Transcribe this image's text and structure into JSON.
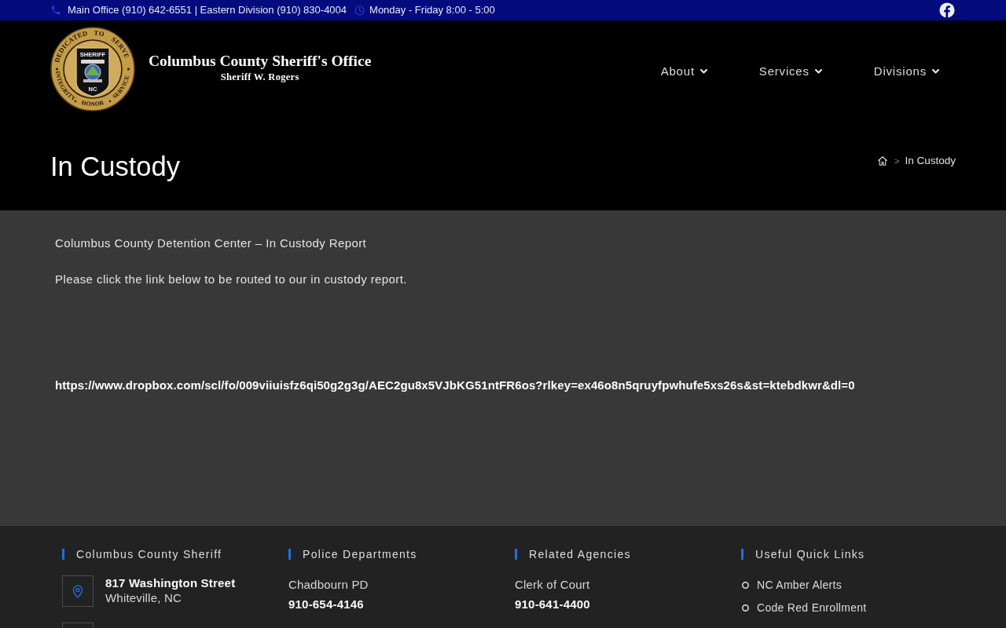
{
  "top_bar": {
    "contact": "Main Office (910) 642-6551 | Eastern Division (910) 830-4004",
    "hours": "Monday - Friday 8:00 - 5:00"
  },
  "header": {
    "seal": {
      "top_arc": [
        "DEDICATED",
        "TO",
        "SERVE"
      ],
      "bottom_arc": [
        "INTEGRITY",
        "HONOR",
        "SERVICE"
      ],
      "badge_top": "SHERIFF",
      "badge_bottom": "NC"
    },
    "title": "Columbus County Sheriff's Office",
    "subtitle": "Sheriff W. Rogers",
    "nav": [
      {
        "label": "About"
      },
      {
        "label": "Services"
      },
      {
        "label": "Divisions"
      }
    ]
  },
  "page_header": {
    "title": "In Custody",
    "breadcrumb": {
      "separator": ">",
      "current": "In Custody"
    }
  },
  "content": {
    "paragraphs": [
      "Columbus County Detention Center – In Custody Report",
      "Please click the link below to be routed to our in custody report."
    ],
    "link": "https://www.dropbox.com/scl/fo/009viiuisfz6qi50g2g3g/AEC2gu8x5VJbKG51ntFR6os?rlkey=ex46o8n5qruyfpwhufe5xs26s&st=ktebdkwr&dl=0"
  },
  "footer": {
    "columns": [
      {
        "heading": "Columbus County Sheriff",
        "kind": "contact",
        "items": [
          {
            "kind": "address",
            "title": "817 Washington Street",
            "detail": "Whiteville, NC"
          },
          {
            "kind": "phone"
          }
        ]
      },
      {
        "heading": "Police Departments",
        "kind": "entries",
        "items": [
          {
            "name": "Chadbourn PD",
            "phone": "910-654-4146"
          }
        ]
      },
      {
        "heading": "Related Agencies",
        "kind": "entries",
        "items": [
          {
            "name": "Clerk of Court",
            "phone": "910-641-4400"
          }
        ]
      },
      {
        "heading": "Useful Quick Links",
        "kind": "links",
        "items": [
          "NC Amber Alerts",
          "Code Red Enrollment"
        ]
      }
    ]
  }
}
